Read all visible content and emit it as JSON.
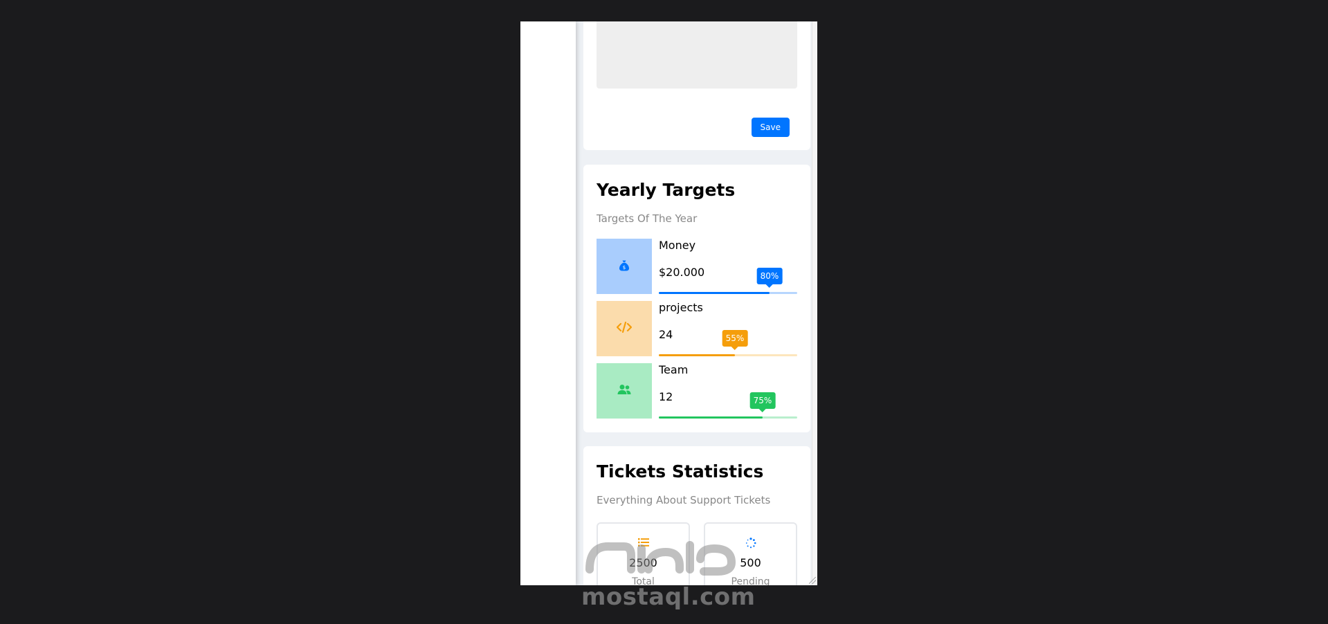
{
  "form": {
    "save_label": "Save"
  },
  "targets": {
    "title": "Yearly Targets",
    "subtitle": "Targets Of The Year",
    "items": [
      {
        "label": "Money",
        "value": "$20.000",
        "percent_label": "80%",
        "percent": 80,
        "icon": "money-bag-icon",
        "color": "#0075ff",
        "bg": "#a9cdfd",
        "track": "#b7d6fe"
      },
      {
        "label": "projects",
        "value": "24",
        "percent_label": "55%",
        "percent": 55,
        "icon": "code-icon",
        "color": "#f59e0b",
        "bg": "#fbdcac",
        "track": "#fde6bd"
      },
      {
        "label": "Team",
        "value": "12",
        "percent_label": "75%",
        "percent": 75,
        "icon": "users-icon",
        "color": "#22c55e",
        "bg": "#a9ebc3",
        "track": "#b9efcd"
      }
    ]
  },
  "tickets": {
    "title": "Tickets Statistics",
    "subtitle": "Everything About Support Tickets",
    "stats": [
      {
        "number": "2500",
        "label": "Total",
        "icon": "list-icon",
        "color": "#f59e0b"
      },
      {
        "number": "500",
        "label": "Pending",
        "icon": "spinner-icon",
        "color": "#0075ff"
      }
    ]
  },
  "watermark": {
    "text": "mostaql.com"
  }
}
